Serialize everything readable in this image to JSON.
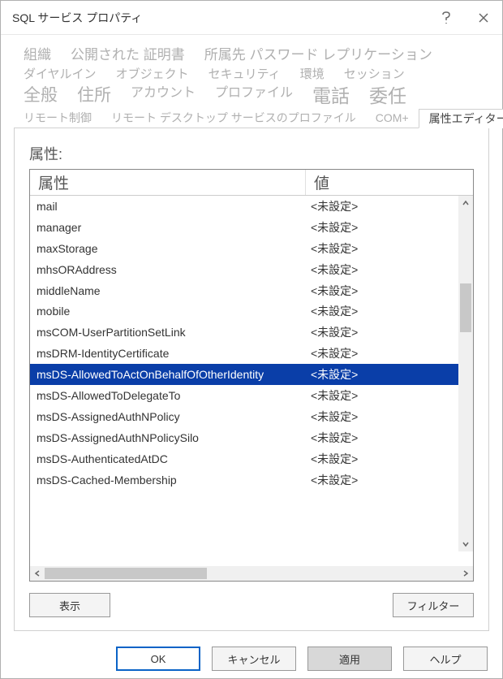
{
  "window": {
    "title": "SQL サービス プロパティ"
  },
  "tabs": {
    "row1": [
      {
        "label": "組織",
        "big": true
      },
      {
        "label": "公開された 証明書"
      },
      {
        "label": "所属先 パスワード レプリケーション"
      }
    ],
    "row2": [
      {
        "label": "ダイヤルイン"
      },
      {
        "label": "オブジェクト"
      },
      {
        "label": "セキュリティ"
      },
      {
        "label": "環境",
        "big": true
      },
      {
        "label": "セッション"
      }
    ],
    "row3": [
      {
        "label": "全般"
      },
      {
        "label": "住所"
      },
      {
        "label": "アカウント"
      },
      {
        "label": "プロファイル"
      },
      {
        "label": "電話",
        "big": true
      },
      {
        "label": "委任",
        "big": true
      }
    ],
    "row4": [
      {
        "label": "リモート制御"
      },
      {
        "label": "リモート デスクトップ サービスのプロファイル"
      },
      {
        "label": "COM+"
      },
      {
        "label": "属性エディター",
        "active": true
      }
    ]
  },
  "attr_section_label": "属性:",
  "list_headers": {
    "attr": "属性",
    "val": "値"
  },
  "not_set": "<未設定>",
  "rows": [
    {
      "name": "mail"
    },
    {
      "name": "manager"
    },
    {
      "name": "maxStorage"
    },
    {
      "name": "mhsORAddress"
    },
    {
      "name": "middleName"
    },
    {
      "name": "mobile"
    },
    {
      "name": "msCOM-UserPartitionSetLink"
    },
    {
      "name": "msDRM-IdentityCertificate"
    },
    {
      "name": "msDS-AllowedToActOnBehalfOfOtherIdentity",
      "selected": true
    },
    {
      "name": "msDS-AllowedToDelegateTo"
    },
    {
      "name": "msDS-AssignedAuthNPolicy"
    },
    {
      "name": "msDS-AssignedAuthNPolicySilo"
    },
    {
      "name": "msDS-AuthenticatedAtDC"
    },
    {
      "name": "msDS-Cached-Membership"
    }
  ],
  "buttons": {
    "view": "表示",
    "filter": "フィルター",
    "ok": "OK",
    "cancel": "キャンセル",
    "apply": "適用",
    "help": "ヘルプ"
  }
}
